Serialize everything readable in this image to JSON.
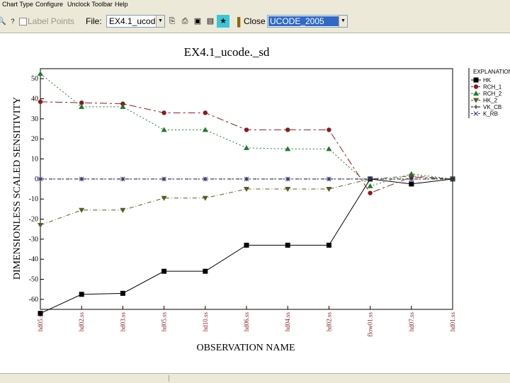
{
  "menu": {
    "items": [
      "Chart Type",
      "Configure",
      "Unclock Toolbar",
      "Help"
    ]
  },
  "toolbar": {
    "label_points": "Label Points",
    "file_label": "File:",
    "file_value": "EX4.1_ucod",
    "close_label": "Close",
    "app_value": "UCODE_2005"
  },
  "chart_data": {
    "type": "line",
    "title": "EX4.1_ucode._sd",
    "xlabel": "OBSERVATION NAME",
    "ylabel": "DIMENSIONLESS SCALED SENSITIVITY",
    "ylim": [
      -65,
      55
    ],
    "yticks": [
      50,
      40,
      30,
      20,
      10,
      0,
      -10,
      -20,
      -30,
      -40,
      -50,
      -60
    ],
    "categories": [
      "hd05.ss",
      "hd02.ss",
      "hd03.ss",
      "hd05.ss",
      "hd10.ss",
      "hd06.ss",
      "hd04.ss",
      "hd02.ss",
      "flow01.ss",
      "hd07.ss",
      "hd01.ss"
    ],
    "legend_title": "EXPLANATION",
    "legend_position": "right",
    "grid": false,
    "series": [
      {
        "name": "HK",
        "color": "#000000",
        "marker": "square",
        "dash": "",
        "values": [
          -67,
          -57.5,
          -57,
          -46,
          -46,
          -33,
          -33,
          -33,
          0,
          -2.5,
          0
        ]
      },
      {
        "name": "RCH_1",
        "color": "#8b1a1a",
        "marker": "circle",
        "dash": "10,4,3,4",
        "values": [
          38.5,
          38,
          37.5,
          33,
          33,
          24.5,
          24.5,
          24.5,
          -7,
          1,
          0
        ]
      },
      {
        "name": "RCH_2",
        "color": "#1f7a2a",
        "marker": "triangle",
        "dash": "2,3",
        "values": [
          52.5,
          36,
          36,
          24.5,
          24.5,
          15.5,
          15,
          15,
          -3.5,
          2.5,
          0
        ]
      },
      {
        "name": "HK_2",
        "color": "#5a5a20",
        "marker": "triangle-down",
        "dash": "6,3,1,3",
        "values": [
          -23,
          -15.5,
          -15.5,
          -9.5,
          -9.5,
          -5,
          -5,
          -5,
          0,
          1.5,
          0
        ]
      },
      {
        "name": "VK_CB",
        "color": "#000000",
        "marker": "plus",
        "dash": "5,3,1,3",
        "values": [
          0,
          0,
          0,
          0,
          0,
          0,
          0,
          0,
          0,
          0,
          0
        ]
      },
      {
        "name": "K_RB",
        "color": "#3a3a8a",
        "marker": "x",
        "dash": "3,3",
        "values": [
          0,
          0,
          0,
          0,
          0,
          0,
          0,
          0,
          0,
          0,
          0
        ]
      }
    ]
  }
}
